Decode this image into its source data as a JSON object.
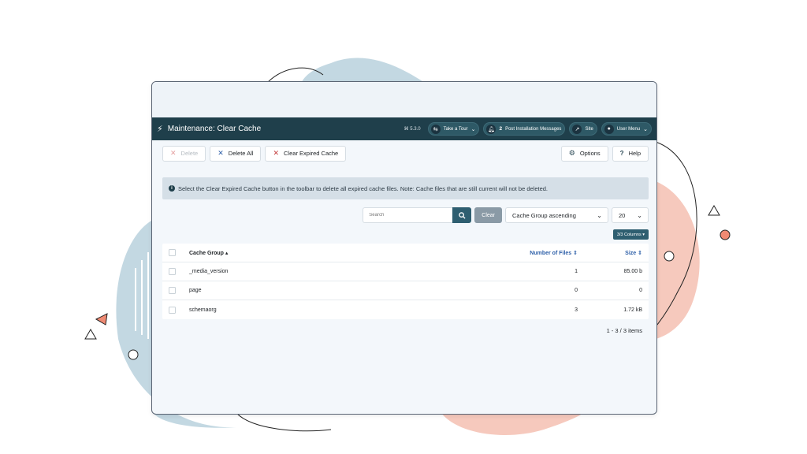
{
  "header": {
    "title": "Maintenance: Clear Cache",
    "version": "⌘ 5.3.0",
    "take_tour": "Take a Tour",
    "post_install_count": "2",
    "post_install_label": "Post Installation Messages",
    "site_label": "Site",
    "user_menu_label": "User Menu"
  },
  "toolbar": {
    "delete_label": "Delete",
    "delete_all_label": "Delete All",
    "clear_expired_label": "Clear Expired Cache",
    "options_label": "Options",
    "help_label": "Help"
  },
  "alert": {
    "text": "Select the Clear Expired Cache button in the toolbar to delete all expired cache files. Note: Cache files that are still current will not be deleted."
  },
  "filters": {
    "search_placeholder": "Search",
    "clear_label": "Clear",
    "ordering_value": "Cache Group ascending",
    "limit_value": "20",
    "columns_label": "3/3 Columns ▾"
  },
  "table": {
    "headers": {
      "group": "Cache Group ▴",
      "files": "Number of Files ⇕",
      "size": "Size ⇕"
    },
    "rows": [
      {
        "group": "_media_version",
        "files": "1",
        "size": "85.00 b"
      },
      {
        "group": "page",
        "files": "0",
        "size": "0"
      },
      {
        "group": "schemaorg",
        "files": "3",
        "size": "1.72 kB"
      }
    ]
  },
  "pagination": {
    "summary": "1 - 3 / 3 items"
  },
  "colors": {
    "header_bg": "#1f3f4b",
    "accent": "#2e5e70",
    "link_blue": "#2d5fa8",
    "danger": "#c23a3a"
  },
  "icons": [
    "bolt-icon",
    "map-signs-icon",
    "bell-icon",
    "external-link-icon",
    "user-icon",
    "close-icon",
    "gear-icon",
    "question-icon",
    "info-icon",
    "search-icon",
    "chevron-down-icon"
  ]
}
